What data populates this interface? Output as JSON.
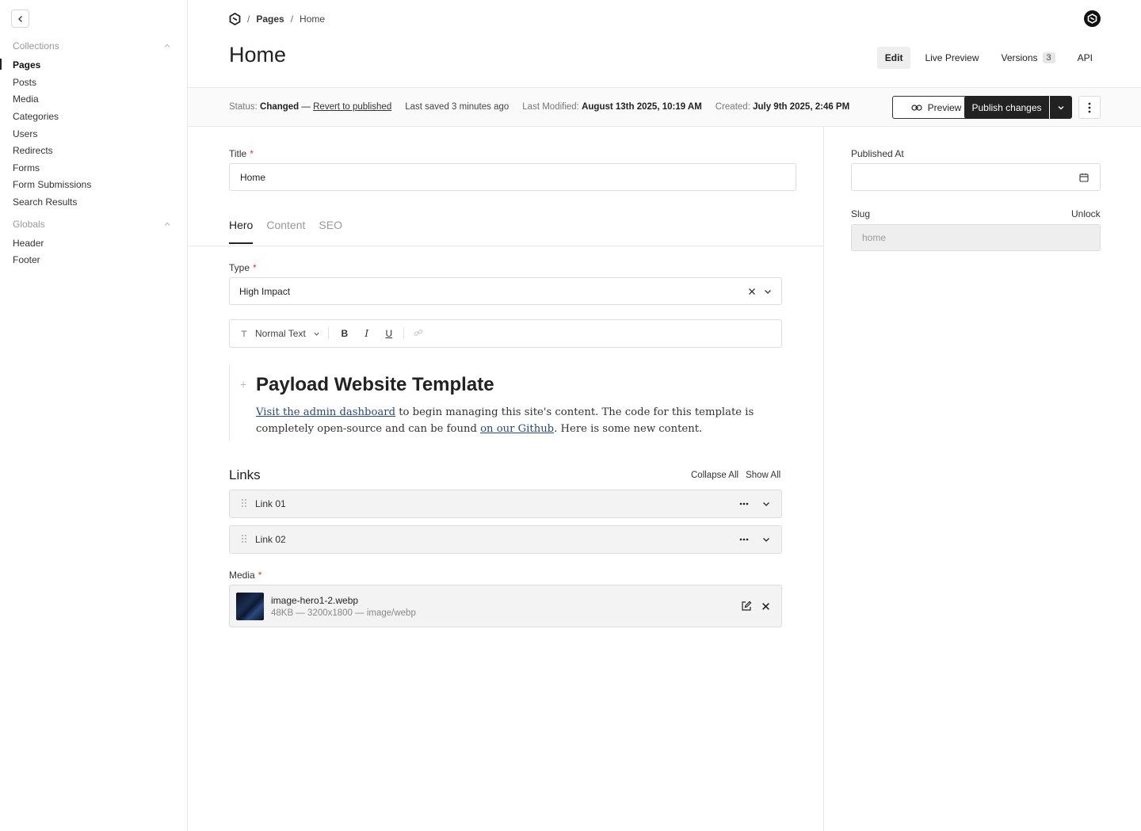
{
  "sidebar": {
    "collections_title": "Collections",
    "collections": [
      {
        "label": "Pages"
      },
      {
        "label": "Posts"
      },
      {
        "label": "Media"
      },
      {
        "label": "Categories"
      },
      {
        "label": "Users"
      },
      {
        "label": "Redirects"
      },
      {
        "label": "Forms"
      },
      {
        "label": "Form Submissions"
      },
      {
        "label": "Search Results"
      }
    ],
    "globals_title": "Globals",
    "globals": [
      {
        "label": "Header"
      },
      {
        "label": "Footer"
      }
    ]
  },
  "breadcrumb": {
    "sep": "/",
    "pages": "Pages",
    "current": "Home"
  },
  "header": {
    "title": "Home",
    "tabs": {
      "edit": "Edit",
      "live_preview": "Live Preview",
      "versions": "Versions",
      "versions_count": "3",
      "api": "API"
    }
  },
  "status": {
    "status_label": "Status:",
    "status_value": "Changed",
    "dash": "—",
    "revert": "Revert to published",
    "last_saved": "Last saved 3 minutes ago",
    "modified_label": "Last Modified:",
    "modified_value": "August 13th 2025, 10:19 AM",
    "created_label": "Created:",
    "created_value": "July 9th 2025, 2:46 PM",
    "preview_label": "Preview",
    "publish_label": "Publish changes"
  },
  "form": {
    "title_label": "Title",
    "required_mark": "*",
    "title_value": "Home",
    "tabs": [
      "Hero",
      "Content",
      "SEO"
    ],
    "type_label": "Type",
    "type_value": "High Impact",
    "toolbar": {
      "block_type": "Normal Text",
      "bold": "B",
      "italic": "I",
      "underline": "U"
    },
    "rich_text": {
      "heading": "Payload Website Template",
      "link1": "Visit the admin dashboard",
      "text1": " to begin managing this site's content. The code for this template is completely open-source and can be found ",
      "link2": "on our Github",
      "text2": ".  Here is some new content."
    },
    "links_title": "Links",
    "collapse_all": "Collapse All",
    "show_all": "Show All",
    "links": [
      {
        "label": "Link 01"
      },
      {
        "label": "Link 02"
      }
    ],
    "media_label": "Media",
    "media": {
      "filename": "image-hero1-2.webp",
      "meta": "48KB — 3200x1800 — image/webp"
    }
  },
  "sidebar_fields": {
    "published_at_label": "Published At",
    "slug_label": "Slug",
    "unlock": "Unlock",
    "slug_value": "home"
  },
  "icons": {
    "back": "chevron-left-icon",
    "collapse": "chevron-up-icon",
    "logo": "payload-logo-icon",
    "link": "link-icon",
    "kebab": "more-vertical-icon",
    "calendar": "calendar-icon",
    "drag": "drag-handle-icon",
    "edit": "edit-icon",
    "close": "close-icon"
  },
  "colors": {
    "primary": "#222222",
    "required": "#d9363e",
    "link": "#2a4b73"
  }
}
